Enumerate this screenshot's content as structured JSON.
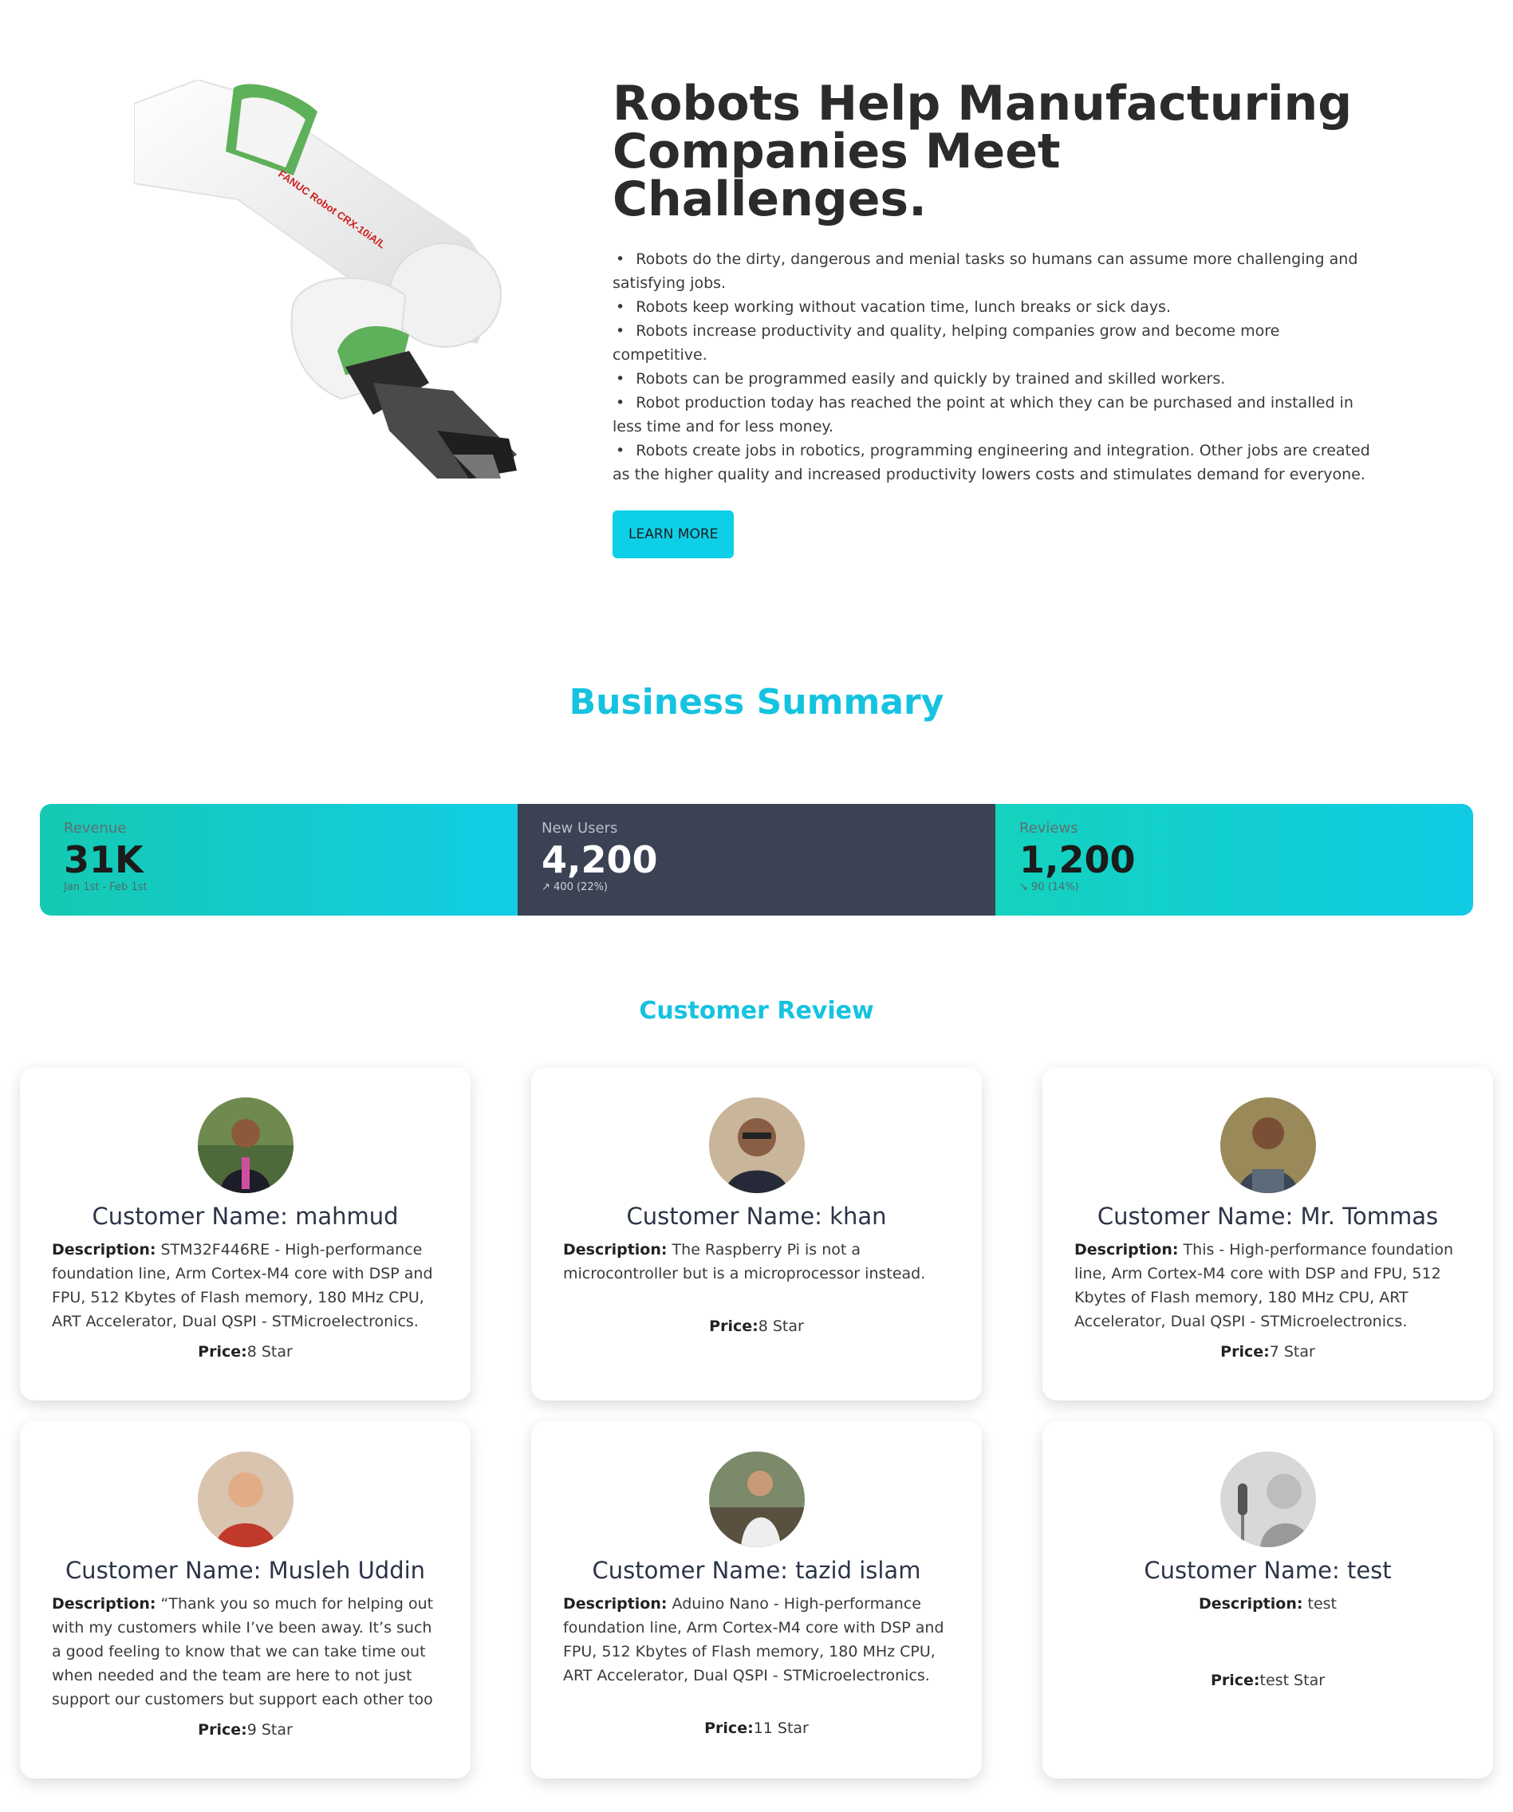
{
  "hero": {
    "title": "Robots Help Manufacturing Companies Meet Challenges.",
    "bullets": [
      "Robots do the dirty, dangerous and menial tasks so humans can assume more challenging and satisfying jobs.",
      "Robots keep working without vacation time, lunch breaks or sick days.",
      "Robots increase productivity and quality, helping companies grow and become more competitive.",
      "Robots can be programmed easily and quickly by trained and skilled workers.",
      "Robot production today has reached the point at which they can be purchased and installed in less time and for less money.",
      "Robots create jobs in robotics, programming engineering and integration. Other jobs are created as the higher quality and increased productivity lowers costs and stimulates demand for everyone."
    ],
    "button_label": "LEARN MORE",
    "robot_label": "FANUC Robot CRX-10iA/L",
    "robot_brand_color": "#cc1f1f",
    "robot_accent_color": "#5fb05a"
  },
  "business_summary": {
    "title": "Business Summary",
    "stats": [
      {
        "title": "Revenue",
        "value": "31K",
        "desc": "Jan 1st - Feb 1st"
      },
      {
        "title": "New Users",
        "value": "4,200",
        "desc": "↗︎ 400 (22%)"
      },
      {
        "title": "Reviews",
        "value": "1,200",
        "desc": "↘︎ 90 (14%)"
      }
    ]
  },
  "customer_review": {
    "title": "Customer Review",
    "desc_label": "Description:",
    "price_label": "Price:",
    "reviews": [
      {
        "name": "Customer Name: mahmud",
        "description": "STM32F446RE - High-performance foundation line, Arm Cortex-M4 core with DSP and FPU, 512 Kbytes of Flash memory, 180 MHz CPU, ART Accelerator, Dual QSPI - STMicroelectronics.",
        "price": "8 Star"
      },
      {
        "name": "Customer Name: khan",
        "description": "The Raspberry Pi is not a microcontroller but is a microprocessor instead.",
        "price": "8 Star"
      },
      {
        "name": "Customer Name: Mr. Tommas",
        "description": "This - High-performance foundation line, Arm Cortex-M4 core with DSP and FPU, 512 Kbytes of Flash memory, 180 MHz CPU, ART Accelerator, Dual QSPI - STMicroelectronics.",
        "price": "7 Star"
      },
      {
        "name": "Customer Name: Musleh Uddin",
        "description": "“Thank you so much for helping out with my customers while I’ve been away. It’s such a good feeling to know that we can take time out when needed and the team are here to not just support our customers but support each other too",
        "price": "9 Star"
      },
      {
        "name": "Customer Name: tazid islam",
        "description": "Aduino Nano - High-performance foundation line, Arm Cortex-M4 core with DSP and FPU, 512 Kbytes of Flash memory, 180 MHz CPU, ART Accelerator, Dual QSPI - STMicroelectronics.",
        "price": "11 Star"
      },
      {
        "name": "Customer Name: test",
        "description": "test",
        "price": "test Star"
      }
    ]
  }
}
